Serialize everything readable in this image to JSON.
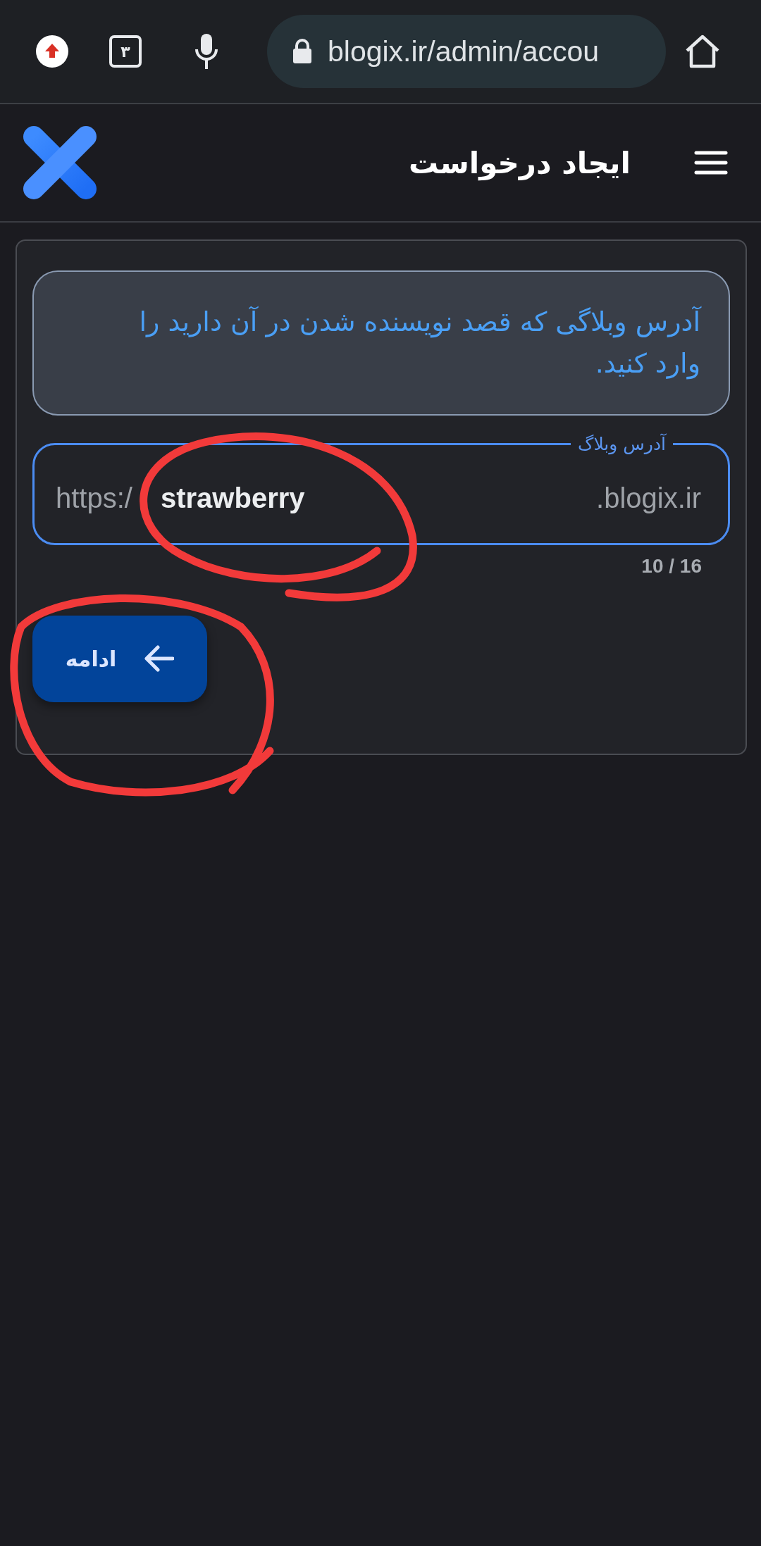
{
  "browser": {
    "tab_count": "۳",
    "url": "blogix.ir/admin/accou"
  },
  "header": {
    "title": "ایجاد درخواست"
  },
  "info": {
    "text": "آدرس وبلاگی که قصد نویسنده شدن در آن دارید را وارد کنید."
  },
  "field": {
    "label": "آدرس وبلاگ",
    "prefix": "https:/",
    "value": "strawberry",
    "suffix": ".blogix.ir",
    "counter": "10 / 16",
    "focused": true
  },
  "button": {
    "label": "ادامه"
  },
  "annotations": [
    {
      "kind": "loop",
      "color": "#f23a3a"
    },
    {
      "kind": "loop",
      "color": "#f23a3a"
    }
  ]
}
